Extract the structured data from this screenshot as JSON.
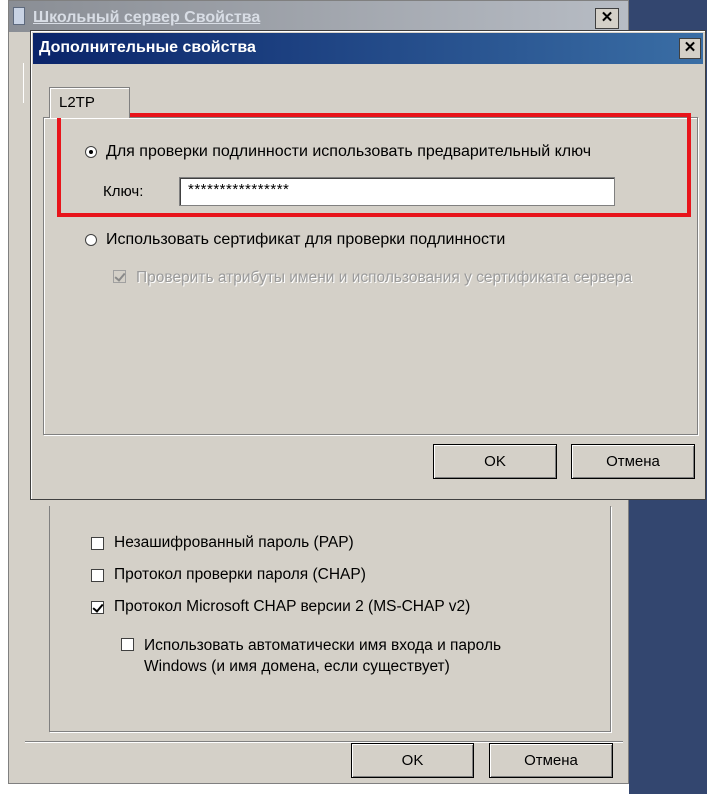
{
  "back_window": {
    "title": "Школьный сервер Свойства",
    "close_label": "✕",
    "checkboxes": [
      {
        "label": "Незашифрованный пароль (PAP)",
        "checked": false
      },
      {
        "label": "Протокол проверки пароля (CHAP)",
        "checked": false
      },
      {
        "label": "Протокол Microsoft CHAP версии 2 (MS-CHAP v2)",
        "checked": true
      },
      {
        "label": "Использовать автоматически имя входа и пароль Windows (и имя домена, если существует)",
        "checked": false
      }
    ],
    "ok_label": "OK",
    "cancel_label": "Отмена"
  },
  "dialog": {
    "title": "Дополнительные свойства",
    "close_label": "✕",
    "tab_label": "L2TP",
    "option_psk": {
      "label": "Для проверки подлинности использовать предварительный ключ",
      "selected": true
    },
    "key_label": "Ключ:",
    "key_value": "****************",
    "option_cert": {
      "label": "Использовать сертификат для проверки подлинности",
      "selected": false
    },
    "verify_cert": {
      "label": "Проверить атрибуты имени и использования у сертификата сервера",
      "checked": true,
      "enabled": false
    },
    "ok_label": "OK",
    "cancel_label": "Отмена"
  },
  "colors": {
    "highlight": "#e8141b",
    "dialog_face": "#d4d0c8",
    "desktop": "#33466f"
  }
}
